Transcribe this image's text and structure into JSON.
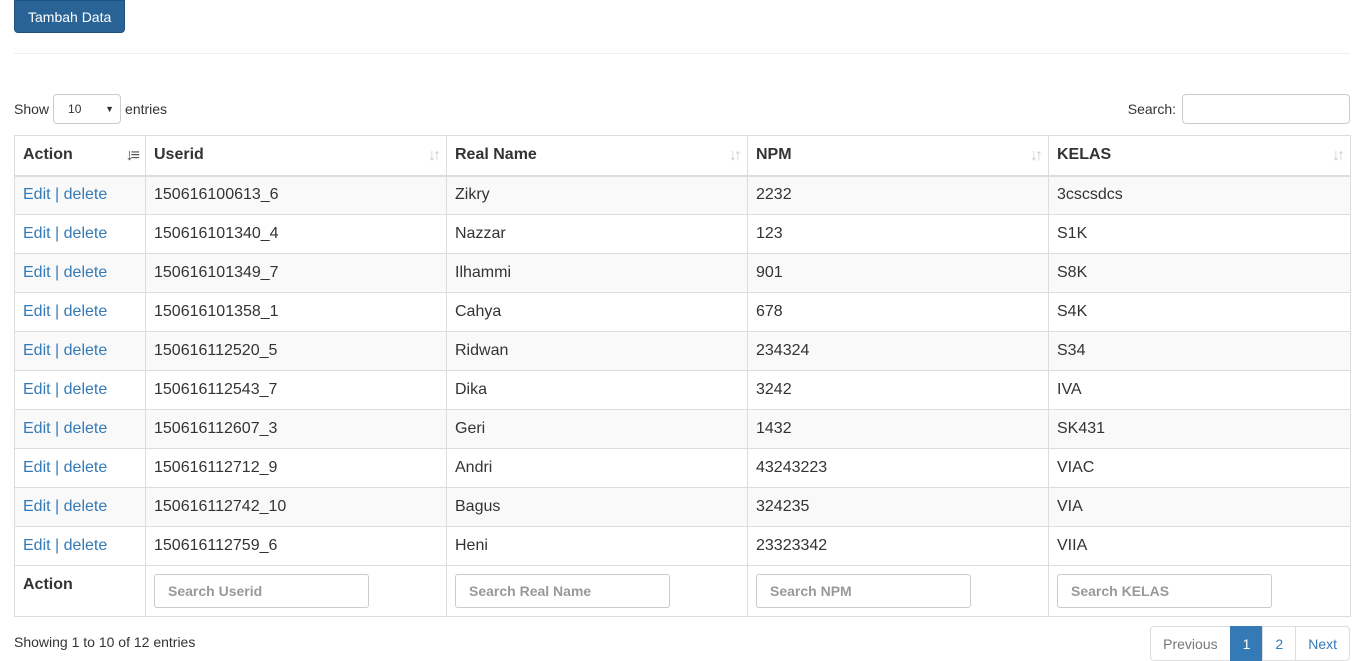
{
  "toolbar": {
    "add_label": "Tambah Data"
  },
  "length": {
    "show_label": "Show",
    "value": "10",
    "entries_label": "entries"
  },
  "search": {
    "label": "Search:",
    "value": ""
  },
  "columns": [
    "Action",
    "Userid",
    "Real Name",
    "NPM",
    "KELAS"
  ],
  "rows": [
    {
      "edit": "Edit",
      "sep": "|",
      "delete": "delete",
      "userid": "150616100613_6",
      "name": "Zikry",
      "npm": "2232",
      "kelas": "3cscsdcs"
    },
    {
      "edit": "Edit",
      "sep": "|",
      "delete": "delete",
      "userid": "150616101340_4",
      "name": "Nazzar",
      "npm": "123",
      "kelas": "S1K"
    },
    {
      "edit": "Edit",
      "sep": "|",
      "delete": "delete",
      "userid": "150616101349_7",
      "name": "Ilhammi",
      "npm": "901",
      "kelas": "S8K"
    },
    {
      "edit": "Edit",
      "sep": "|",
      "delete": "delete",
      "userid": "150616101358_1",
      "name": "Cahya",
      "npm": "678",
      "kelas": "S4K"
    },
    {
      "edit": "Edit",
      "sep": "|",
      "delete": "delete",
      "userid": "150616112520_5",
      "name": "Ridwan",
      "npm": "234324",
      "kelas": "S34"
    },
    {
      "edit": "Edit",
      "sep": "|",
      "delete": "delete",
      "userid": "150616112543_7",
      "name": "Dika",
      "npm": "3242",
      "kelas": "IVA"
    },
    {
      "edit": "Edit",
      "sep": "|",
      "delete": "delete",
      "userid": "150616112607_3",
      "name": "Geri",
      "npm": "1432",
      "kelas": "SK431"
    },
    {
      "edit": "Edit",
      "sep": "|",
      "delete": "delete",
      "userid": "150616112712_9",
      "name": "Andri",
      "npm": "43243223",
      "kelas": "VIAC"
    },
    {
      "edit": "Edit",
      "sep": "|",
      "delete": "delete",
      "userid": "150616112742_10",
      "name": "Bagus",
      "npm": "324235",
      "kelas": "VIA"
    },
    {
      "edit": "Edit",
      "sep": "|",
      "delete": "delete",
      "userid": "150616112759_6",
      "name": "Heni",
      "npm": "23323342",
      "kelas": "VIIA"
    }
  ],
  "footer": {
    "action_label": "Action",
    "placeholders": [
      "Search Userid",
      "Search Real Name",
      "Search NPM",
      "Search KELAS"
    ]
  },
  "info": "Showing 1 to 10 of 12 entries",
  "pagination": {
    "previous": "Previous",
    "pages": [
      "1",
      "2"
    ],
    "next": "Next"
  },
  "colors": {
    "primary": "#337ab7",
    "button": "#2a6496"
  }
}
